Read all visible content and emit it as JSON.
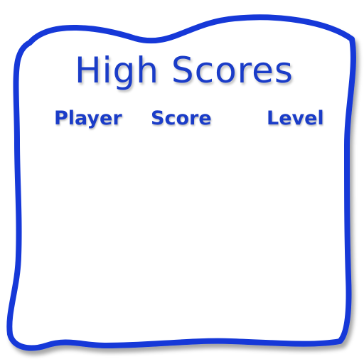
{
  "screen": {
    "title": "High Scores",
    "columns": {
      "player": "Player",
      "score": "Score",
      "level": "Level"
    },
    "rows": []
  },
  "colors": {
    "frame": "#1238d8",
    "text": "#1a3cc8",
    "background": "#ffffff"
  }
}
